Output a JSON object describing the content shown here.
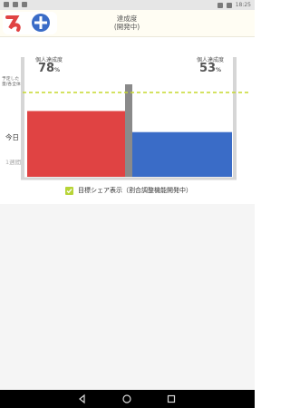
{
  "status": {
    "time": "18:25"
  },
  "header": {
    "title": "達成度",
    "subtitle": "(開発中)"
  },
  "chart": {
    "target_label_line1": "予定した",
    "target_label_line2": "量/各全体",
    "today_label": "今日",
    "week_label": "1週間",
    "left": {
      "label": "個人達成度",
      "value": "78",
      "unit": "%"
    },
    "right": {
      "label": "個人達成度",
      "value": "53",
      "unit": "%"
    }
  },
  "chart_data": {
    "type": "bar",
    "categories": [
      "左",
      "右"
    ],
    "values": [
      78,
      53
    ],
    "target": 100,
    "ylim": [
      0,
      100
    ],
    "colors": [
      "#e04343",
      "#3a6cc7"
    ],
    "divider_color": "#8a8a8a",
    "target_color": "#c5d82d"
  },
  "toggle": {
    "label": "目標シェア表示（割合調整機能開発中）",
    "checked": true
  },
  "nav": {
    "back_icon": "back-icon",
    "home_icon": "home-icon",
    "recent_icon": "recent-icon"
  }
}
